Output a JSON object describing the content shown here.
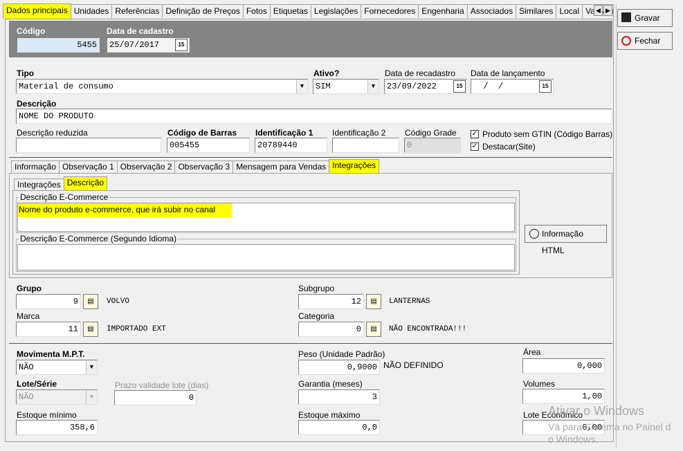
{
  "tabs": [
    "Dados principais",
    "Unidades",
    "Referências",
    "Definição de Preços",
    "Fotos",
    "Etiquetas",
    "Legislações",
    "Fornecedores",
    "Engenharia",
    "Associados",
    "Similares",
    "Local",
    "Val.Nutric"
  ],
  "header": {
    "codigo_label": "Código",
    "codigo_value": "5455",
    "data_cadastro_label": "Data de cadastro",
    "data_cadastro_value": "25/07/2017"
  },
  "side_buttons": {
    "gravar": "Gravar",
    "fechar": "Fechar"
  },
  "form": {
    "tipo_label": "Tipo",
    "tipo_value": "Material de consumo",
    "ativo_label": "Ativo?",
    "ativo_value": "SIM",
    "recadastro_label": "Data de recadastro",
    "recadastro_value": "23/09/2022",
    "lancamento_label": "Data de lançamento",
    "lancamento_value": "  /  /",
    "descricao_label": "Descrição",
    "descricao_value": "NOME DO PRODUTO",
    "desc_reduzida_label": "Descrição reduzida",
    "desc_reduzida_value": "",
    "codigo_barras_label": "Código de Barras",
    "codigo_barras_value": "005455",
    "ident1_label": "Identificação 1",
    "ident1_value": "20789440",
    "ident2_label": "Identificação 2",
    "ident2_value": "",
    "codigo_grade_label": "Código Grade",
    "codigo_grade_value": "0",
    "sem_gtin_label": "Produto sem GTIN (Código Barras)",
    "destacar_label": "Destacar(Site)"
  },
  "inner_tabs": [
    "Informação",
    "Observação 1",
    "Observação 2",
    "Observação 3",
    "Mensagem para Vendas",
    "Integrações"
  ],
  "sub_tabs": [
    "Integrações",
    "Descrição"
  ],
  "ecommerce": {
    "desc_label": "Descrição E-Commerce",
    "desc_value": "Nome do produto e-commerce, que irá subir no canal",
    "desc2_label": "Descrição E-Commerce (Segundo Idioma)",
    "desc2_value": "",
    "info_html_button": "Informação HTML"
  },
  "classificacao": {
    "grupo_label": "Grupo",
    "grupo_value": "9",
    "grupo_desc": "VOLVO",
    "marca_label": "Marca",
    "marca_value": "11",
    "marca_desc": "IMPORTADO EXT",
    "subgrupo_label": "Subgrupo",
    "subgrupo_value": "12",
    "subgrupo_desc": "LANTERNAS",
    "categoria_label": "Categoria",
    "categoria_value": "0",
    "categoria_desc": "NÃO ENCONTRADA!!!"
  },
  "estoque": {
    "mpt_label": "Movimenta M.P.T.",
    "mpt_value": "NÃO",
    "lote_label": "Lote/Série",
    "lote_value": "NÃO",
    "prazo_label": "Prazo validade lote (dias)",
    "prazo_value": "0",
    "estoque_min_label": "Estoque mínimo",
    "estoque_min_value": "358,6",
    "peso_label": "Peso (Unidade Padrão)",
    "peso_value": "0,9000",
    "peso_desc": "NÃO DEFINIDO",
    "garantia_label": "Garantia (meses)",
    "garantia_value": "3",
    "estoque_max_label": "Estoque máximo",
    "estoque_max_value": "0,0",
    "area_label": "Área",
    "area_value": "0,000",
    "volumes_label": "Volumes",
    "volumes_value": "1,00",
    "lote_eco_label": "Lote Econômico",
    "lote_eco_value": "0,00"
  },
  "watermark": {
    "line1": "Ativar o Windows",
    "line2": "Vá para Sistema no Painel d",
    "line3": "o Windows."
  }
}
